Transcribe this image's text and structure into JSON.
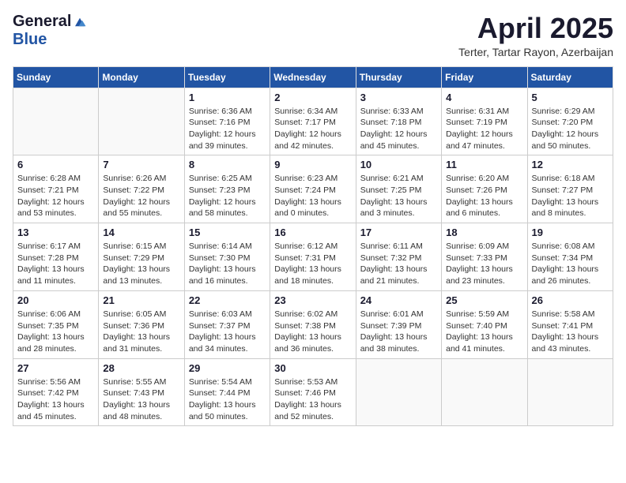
{
  "logo": {
    "general": "General",
    "blue": "Blue"
  },
  "title": "April 2025",
  "location": "Terter, Tartar Rayon, Azerbaijan",
  "days_of_week": [
    "Sunday",
    "Monday",
    "Tuesday",
    "Wednesday",
    "Thursday",
    "Friday",
    "Saturday"
  ],
  "weeks": [
    [
      {
        "day": "",
        "info": ""
      },
      {
        "day": "",
        "info": ""
      },
      {
        "day": "1",
        "info": "Sunrise: 6:36 AM\nSunset: 7:16 PM\nDaylight: 12 hours and 39 minutes."
      },
      {
        "day": "2",
        "info": "Sunrise: 6:34 AM\nSunset: 7:17 PM\nDaylight: 12 hours and 42 minutes."
      },
      {
        "day": "3",
        "info": "Sunrise: 6:33 AM\nSunset: 7:18 PM\nDaylight: 12 hours and 45 minutes."
      },
      {
        "day": "4",
        "info": "Sunrise: 6:31 AM\nSunset: 7:19 PM\nDaylight: 12 hours and 47 minutes."
      },
      {
        "day": "5",
        "info": "Sunrise: 6:29 AM\nSunset: 7:20 PM\nDaylight: 12 hours and 50 minutes."
      }
    ],
    [
      {
        "day": "6",
        "info": "Sunrise: 6:28 AM\nSunset: 7:21 PM\nDaylight: 12 hours and 53 minutes."
      },
      {
        "day": "7",
        "info": "Sunrise: 6:26 AM\nSunset: 7:22 PM\nDaylight: 12 hours and 55 minutes."
      },
      {
        "day": "8",
        "info": "Sunrise: 6:25 AM\nSunset: 7:23 PM\nDaylight: 12 hours and 58 minutes."
      },
      {
        "day": "9",
        "info": "Sunrise: 6:23 AM\nSunset: 7:24 PM\nDaylight: 13 hours and 0 minutes."
      },
      {
        "day": "10",
        "info": "Sunrise: 6:21 AM\nSunset: 7:25 PM\nDaylight: 13 hours and 3 minutes."
      },
      {
        "day": "11",
        "info": "Sunrise: 6:20 AM\nSunset: 7:26 PM\nDaylight: 13 hours and 6 minutes."
      },
      {
        "day": "12",
        "info": "Sunrise: 6:18 AM\nSunset: 7:27 PM\nDaylight: 13 hours and 8 minutes."
      }
    ],
    [
      {
        "day": "13",
        "info": "Sunrise: 6:17 AM\nSunset: 7:28 PM\nDaylight: 13 hours and 11 minutes."
      },
      {
        "day": "14",
        "info": "Sunrise: 6:15 AM\nSunset: 7:29 PM\nDaylight: 13 hours and 13 minutes."
      },
      {
        "day": "15",
        "info": "Sunrise: 6:14 AM\nSunset: 7:30 PM\nDaylight: 13 hours and 16 minutes."
      },
      {
        "day": "16",
        "info": "Sunrise: 6:12 AM\nSunset: 7:31 PM\nDaylight: 13 hours and 18 minutes."
      },
      {
        "day": "17",
        "info": "Sunrise: 6:11 AM\nSunset: 7:32 PM\nDaylight: 13 hours and 21 minutes."
      },
      {
        "day": "18",
        "info": "Sunrise: 6:09 AM\nSunset: 7:33 PM\nDaylight: 13 hours and 23 minutes."
      },
      {
        "day": "19",
        "info": "Sunrise: 6:08 AM\nSunset: 7:34 PM\nDaylight: 13 hours and 26 minutes."
      }
    ],
    [
      {
        "day": "20",
        "info": "Sunrise: 6:06 AM\nSunset: 7:35 PM\nDaylight: 13 hours and 28 minutes."
      },
      {
        "day": "21",
        "info": "Sunrise: 6:05 AM\nSunset: 7:36 PM\nDaylight: 13 hours and 31 minutes."
      },
      {
        "day": "22",
        "info": "Sunrise: 6:03 AM\nSunset: 7:37 PM\nDaylight: 13 hours and 34 minutes."
      },
      {
        "day": "23",
        "info": "Sunrise: 6:02 AM\nSunset: 7:38 PM\nDaylight: 13 hours and 36 minutes."
      },
      {
        "day": "24",
        "info": "Sunrise: 6:01 AM\nSunset: 7:39 PM\nDaylight: 13 hours and 38 minutes."
      },
      {
        "day": "25",
        "info": "Sunrise: 5:59 AM\nSunset: 7:40 PM\nDaylight: 13 hours and 41 minutes."
      },
      {
        "day": "26",
        "info": "Sunrise: 5:58 AM\nSunset: 7:41 PM\nDaylight: 13 hours and 43 minutes."
      }
    ],
    [
      {
        "day": "27",
        "info": "Sunrise: 5:56 AM\nSunset: 7:42 PM\nDaylight: 13 hours and 45 minutes."
      },
      {
        "day": "28",
        "info": "Sunrise: 5:55 AM\nSunset: 7:43 PM\nDaylight: 13 hours and 48 minutes."
      },
      {
        "day": "29",
        "info": "Sunrise: 5:54 AM\nSunset: 7:44 PM\nDaylight: 13 hours and 50 minutes."
      },
      {
        "day": "30",
        "info": "Sunrise: 5:53 AM\nSunset: 7:46 PM\nDaylight: 13 hours and 52 minutes."
      },
      {
        "day": "",
        "info": ""
      },
      {
        "day": "",
        "info": ""
      },
      {
        "day": "",
        "info": ""
      }
    ]
  ]
}
